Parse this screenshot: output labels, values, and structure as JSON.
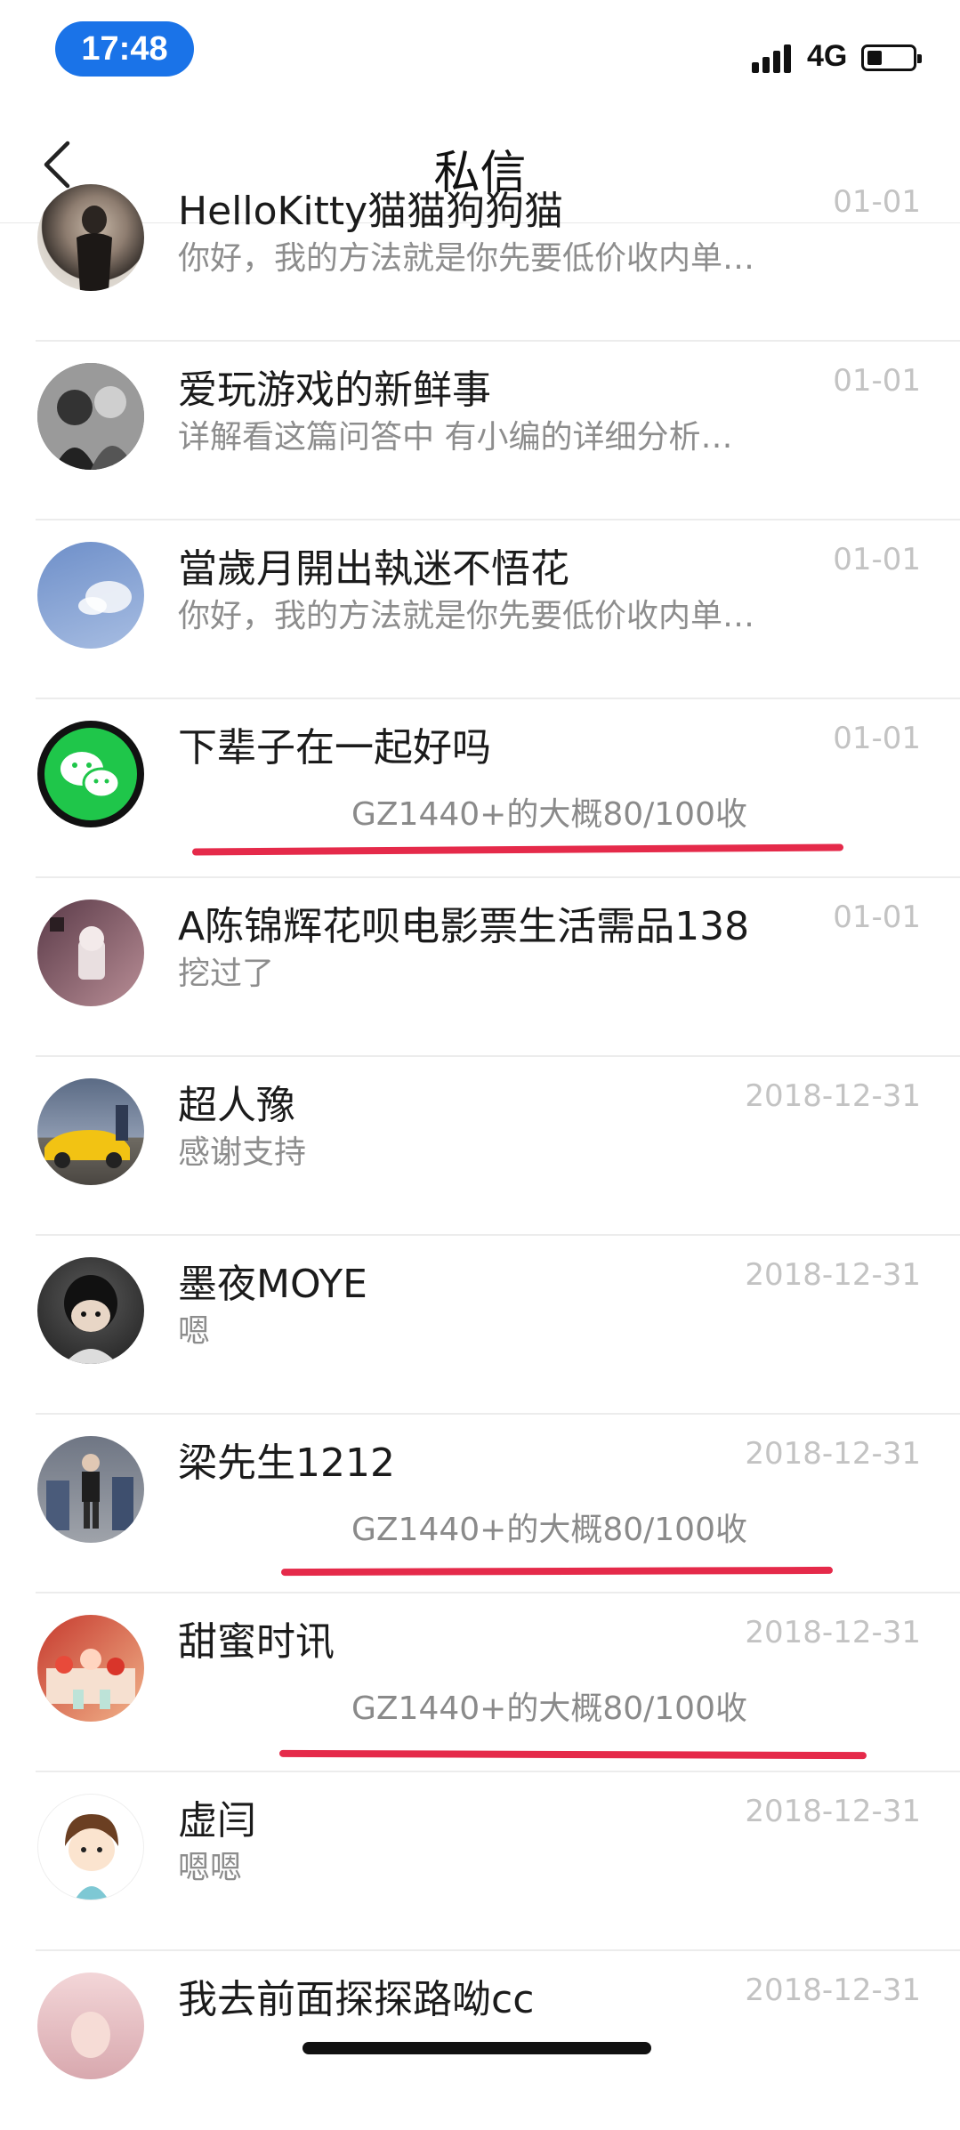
{
  "status": {
    "time": "17:48",
    "network": "4G",
    "battery_level": 0.3
  },
  "nav": {
    "title": "私信",
    "back_icon": "chevron-left-icon"
  },
  "messages": [
    {
      "name": "HelloKitty猫猫狗狗猫",
      "preview": "你好，我的方法就是你先要低价收内单…",
      "date": "01-01",
      "avatar_icon": "avatar-woman-photo"
    },
    {
      "name": "爱玩游戏的新鲜事",
      "preview": "详解看这篇问答中 有小编的详细分析…",
      "date": "01-01",
      "avatar_icon": "avatar-couple-photo"
    },
    {
      "name": "當歲月開出執迷不悟花",
      "preview": "你好，我的方法就是你先要低价收内单…",
      "date": "01-01",
      "avatar_icon": "avatar-sky-cloud"
    },
    {
      "name": "下辈子在一起好吗",
      "preview": "GZ1440+的大概80/100收",
      "date": "01-01",
      "avatar_icon": "avatar-wechat-logo",
      "highlighted": true
    },
    {
      "name": "A陈锦辉花呗电影票生活需品138",
      "preview": "挖过了",
      "date": "01-01",
      "avatar_icon": "avatar-drink-photo"
    },
    {
      "name": "超人豫",
      "preview": "感谢支持",
      "date": "2018-12-31",
      "avatar_icon": "avatar-car-photo"
    },
    {
      "name": "墨夜MOYE",
      "preview": "嗯",
      "date": "2018-12-31",
      "avatar_icon": "avatar-cartoon-boy"
    },
    {
      "name": "梁先生1212",
      "preview": "GZ1440+的大概80/100收",
      "date": "2018-12-31",
      "avatar_icon": "avatar-man-photo",
      "highlighted": true
    },
    {
      "name": "甜蜜时讯",
      "preview": "GZ1440+的大概80/100收",
      "date": "2018-12-31",
      "avatar_icon": "avatar-dessert-photo",
      "highlighted": true
    },
    {
      "name": "虚闫",
      "preview": "嗯嗯",
      "date": "2018-12-31",
      "avatar_icon": "avatar-cartoon-girl"
    },
    {
      "name": "我去前面探探路呦cc",
      "preview": "",
      "date": "2018-12-31",
      "avatar_icon": "avatar-portrait-photo"
    }
  ],
  "colors": {
    "accent_red": "#e52a4a",
    "time_pill": "#1a73e8",
    "wechat_green": "#1fc64a"
  }
}
